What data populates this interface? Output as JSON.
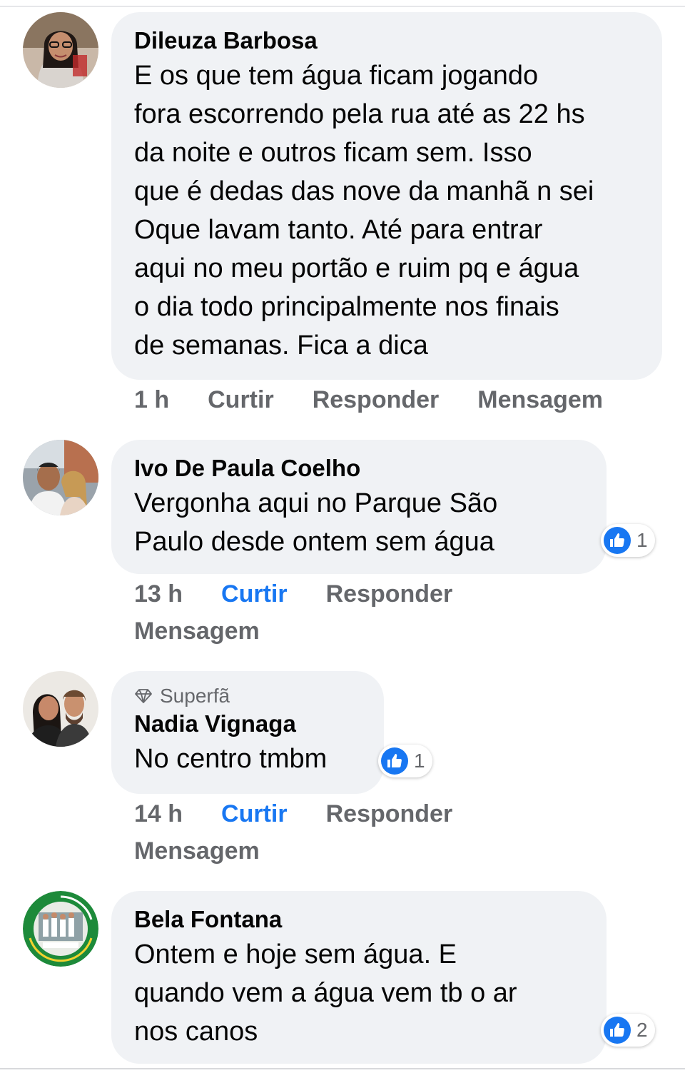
{
  "comments": [
    {
      "author": "Dileuza Barbosa",
      "text_lines": [
        "E os que tem água ficam jogando",
        "fora escorrendo pela rua até as 22 hs",
        "da noite e outros ficam sem. Isso",
        "que é dedas das nove da manhã n sei",
        "Oque lavam tanto. Até para entrar",
        "aqui no meu portão e ruim pq e água",
        "o dia todo principalmente nos finais",
        "de semanas. Fica a dica"
      ],
      "time": "1 h",
      "like": "Curtir",
      "reply": "Responder",
      "message": "Mensagem"
    },
    {
      "author": "Ivo De Paula Coelho",
      "text_lines": [
        "Vergonha aqui no Parque São",
        "Paulo desde ontem sem água"
      ],
      "time": "13 h",
      "like": "Curtir",
      "reply": "Responder",
      "message": "Mensagem",
      "reactions": "1",
      "reaction_icon": "like-icon"
    },
    {
      "badge": "Superfã",
      "badge_icon": "diamond-icon",
      "author": "Nadia Vignaga",
      "text_lines": [
        "No centro tmbm"
      ],
      "time": "14 h",
      "like": "Curtir",
      "reply": "Responder",
      "message": "Mensagem",
      "reactions": "1",
      "reaction_icon": "like-icon"
    },
    {
      "author": "Bela Fontana",
      "text_lines": [
        "Ontem e hoje sem água.  E",
        "quando vem a água vem tb o ar",
        "nos canos"
      ],
      "reactions": "2",
      "reaction_icon": "like-icon"
    }
  ],
  "colors": {
    "bubble": "#f0f2f5",
    "liked": "#1877f2",
    "meta": "#65676b",
    "text": "#050505"
  }
}
